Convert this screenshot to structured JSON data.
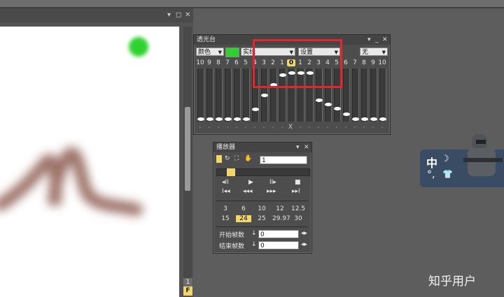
{
  "canvas": {
    "titlebar_icons": [
      "▾",
      "◻",
      "✕"
    ],
    "frame_number": "1",
    "frame_flag": "F"
  },
  "onion_skin": {
    "title": "透光台",
    "controls": [
      "▾",
      "_",
      "✕"
    ],
    "color_mode": "颜色",
    "line_style": "实线",
    "settings": "设置",
    "none_option": "无",
    "swatch_color": "#2fd12f",
    "frame_labels": [
      "10",
      "9",
      "8",
      "7",
      "6",
      "5",
      "4",
      "3",
      "2",
      "1",
      "0",
      "1",
      "2",
      "3",
      "4",
      "5",
      "6",
      "7",
      "8",
      "9",
      "10"
    ],
    "footer_x": "X",
    "levels": [
      0.0,
      0.0,
      0.0,
      0.0,
      0.0,
      0.0,
      0.2,
      0.48,
      0.7,
      0.9,
      0.94,
      0.94,
      0.94,
      0.38,
      0.3,
      0.22,
      0.1,
      0.0,
      0.0,
      0.0,
      0.0
    ]
  },
  "player": {
    "title": "播放器",
    "controls": [
      "▾",
      "✕"
    ],
    "frame_field": "1",
    "transport_row1": [
      "◂II",
      "▶",
      "II▸",
      "■"
    ],
    "transport_row2": [
      "I◂◂",
      "◂◂◂",
      "▸▸▸",
      "▸▸I"
    ],
    "fps_row1": [
      "3",
      "6",
      "10",
      "12",
      "12.5"
    ],
    "fps_row2": [
      "15",
      "24",
      "25",
      "29.97",
      "30"
    ],
    "start_label": "开始帧数",
    "start_value": "0",
    "end_label": "结束帧数",
    "end_value": "0"
  },
  "ime": {
    "lang": "中",
    "moon": "☽",
    "punct": "°,",
    "shirt": "👕"
  },
  "watermark": "知乎用户"
}
